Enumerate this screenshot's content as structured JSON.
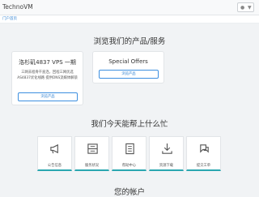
{
  "header": {
    "brand": "TechnoVM",
    "breadcrumb": "门户首页"
  },
  "products": {
    "title": "浏览我们的产品/服务",
    "cards": [
      {
        "title": "洛杉矶4837 VPS 一期",
        "desc": "三网去程骨干直连，回程三网优选AS4837优化线路 提供DNS流媒体解锁",
        "button": "浏览产品"
      },
      {
        "title": "Special Offers",
        "button": "浏览产品"
      }
    ]
  },
  "help": {
    "title": "我们今天能帮上什么忙",
    "tiles": [
      {
        "label": "公告信息",
        "icon": "megaphone-icon"
      },
      {
        "label": "服务状况",
        "icon": "server-icon"
      },
      {
        "label": "帮助中心",
        "icon": "book-icon"
      },
      {
        "label": "资源下载",
        "icon": "download-icon"
      },
      {
        "label": "提交工单",
        "icon": "ticket-icon"
      }
    ]
  },
  "account": {
    "title": "您的帐户"
  },
  "colors": {
    "accent": "#2a7ed0",
    "tile_border": "#2aa7b0"
  }
}
